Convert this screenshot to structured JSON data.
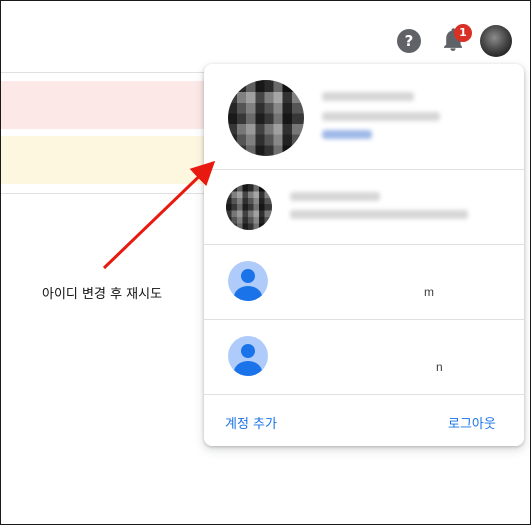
{
  "header": {
    "help_glyph": "?",
    "notification_count": "1"
  },
  "menu": {
    "accounts": [
      {
        "kind": "photo-blurred"
      },
      {
        "kind": "photo-blurred"
      },
      {
        "kind": "generic",
        "trailing_text": "m"
      },
      {
        "kind": "generic",
        "trailing_text": "n"
      }
    ],
    "add_account_label": "계정 추가",
    "logout_label": "로그아웃"
  },
  "annotation": {
    "text": "아이디 변경 후 재시도"
  },
  "colors": {
    "accent": "#1a73e8",
    "badge": "#d93025",
    "annotation_arrow": "#e8190f",
    "row_pink": "#fce8e6",
    "row_yellow": "#fef7e0"
  }
}
